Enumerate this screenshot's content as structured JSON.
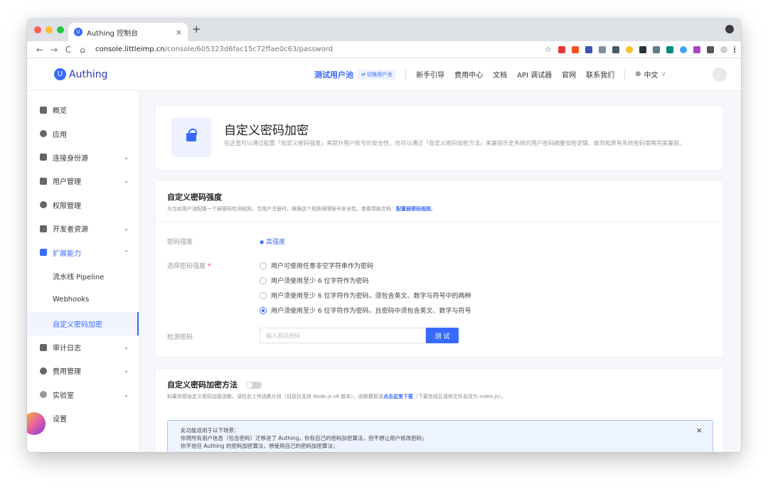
{
  "browser": {
    "tab_title": "Authing 控制台",
    "tab_close": "×",
    "new_tab": "+",
    "url_host": "console.littleimp.cn",
    "url_path": "/console/605323d6fac15c72ffae0c63/password",
    "nav_back": "←",
    "nav_forward": "→",
    "nav_reload": "C",
    "nav_home": "⌂",
    "lock_symbol": "🔒",
    "bookmark_star": "☆"
  },
  "header": {
    "logo_text": "Authing",
    "logo_glyph": "U",
    "user_pool": "测试用户池",
    "switch_pool": "⇄ 切换用户池",
    "links": [
      "新手引导",
      "费用中心",
      "文档",
      "API 调试器",
      "官网",
      "联系我们"
    ],
    "language": "中文",
    "language_caret": "∨",
    "globe": "⊕"
  },
  "sidebar": {
    "items": [
      {
        "label": "概览",
        "icon": "dashboard-icon",
        "chevron": ""
      },
      {
        "label": "应用",
        "icon": "app-icon",
        "chevron": ""
      },
      {
        "label": "连接身份源",
        "icon": "identity-source-icon",
        "chevron": "⌄"
      },
      {
        "label": "用户管理",
        "icon": "user-icon",
        "chevron": "⌄"
      },
      {
        "label": "权限管理",
        "icon": "permission-icon",
        "chevron": ""
      },
      {
        "label": "开发者资源",
        "icon": "developer-icon",
        "chevron": "⌄"
      },
      {
        "label": "扩展能力",
        "icon": "extension-icon",
        "chevron": "⌃"
      },
      {
        "label": "流水线 Pipeline",
        "icon": "",
        "chevron": ""
      },
      {
        "label": "Webhooks",
        "icon": "",
        "chevron": ""
      },
      {
        "label": "自定义密码加密",
        "icon": "",
        "chevron": ""
      },
      {
        "label": "审计日志",
        "icon": "audit-log-icon",
        "chevron": "⌄"
      },
      {
        "label": "费用管理",
        "icon": "billing-icon",
        "chevron": "⌄"
      },
      {
        "label": "实验室",
        "icon": "lab-icon",
        "chevron": "⌄"
      },
      {
        "label": "设置",
        "icon": "settings-icon",
        "chevron": ""
      }
    ]
  },
  "page": {
    "title": "自定义密码加密",
    "description": "在这里可以通过配置「自定义密码强度」来提升用户账号的安全性，也可以通过「自定义密码加密方法」来兼容历史系统的用户密码摘要加密逻辑，做到和原有系统密码策略完美兼容。"
  },
  "strength_section": {
    "title": "自定义密码强度",
    "description": "为当前用户池配置一个弱密码检测规则，当用户注册时，根据这个规则保障账号安全性。查看帮助文档：",
    "link": "配置弱密码规则",
    "link_tail": "。",
    "strength_label": "密码强度",
    "strength_value": "▪ 高强度",
    "select_label": "选择密码强度",
    "required_mark": "*",
    "options": [
      "用户可使用任意非空字符串作为密码",
      "用户须使用至少 6 位字符作为密码",
      "用户须使用至少 6 位字符作为密码，须包含英文、数字与符号中的两种",
      "用户须使用至少 6 位字符作为密码，且密码中须包含英文、数字与符号"
    ],
    "selected_index": 3,
    "test_label": "检测密码",
    "test_placeholder": "输入测试密码",
    "test_button": "测 试"
  },
  "encrypt_section": {
    "title": "自定义密码加密方法",
    "toggle_on": false,
    "description_pre": "如果你想自定义密码加密函数，请在此上传函数片段（目前仅支持 Node.js v8 版本），函数模板请",
    "description_link": "点击这里下载",
    "description_post": "（下载完成后请将文件名改为 index.js）。",
    "notice_lines": [
      "此功能适用于以下场景：",
      "你将所有用户信息（包含密码）迁移进了 Authing，你有自己的密码加密算法，但不想让用户修改密码；",
      "你不信任 Authing 的密码加密算法，想使用自己的密码加密算法；"
    ],
    "notice_close": "×"
  },
  "colors": {
    "primary": "#396aff",
    "traffic_red": "#ff5f57",
    "traffic_yellow": "#febc2e",
    "traffic_green": "#28c840"
  }
}
